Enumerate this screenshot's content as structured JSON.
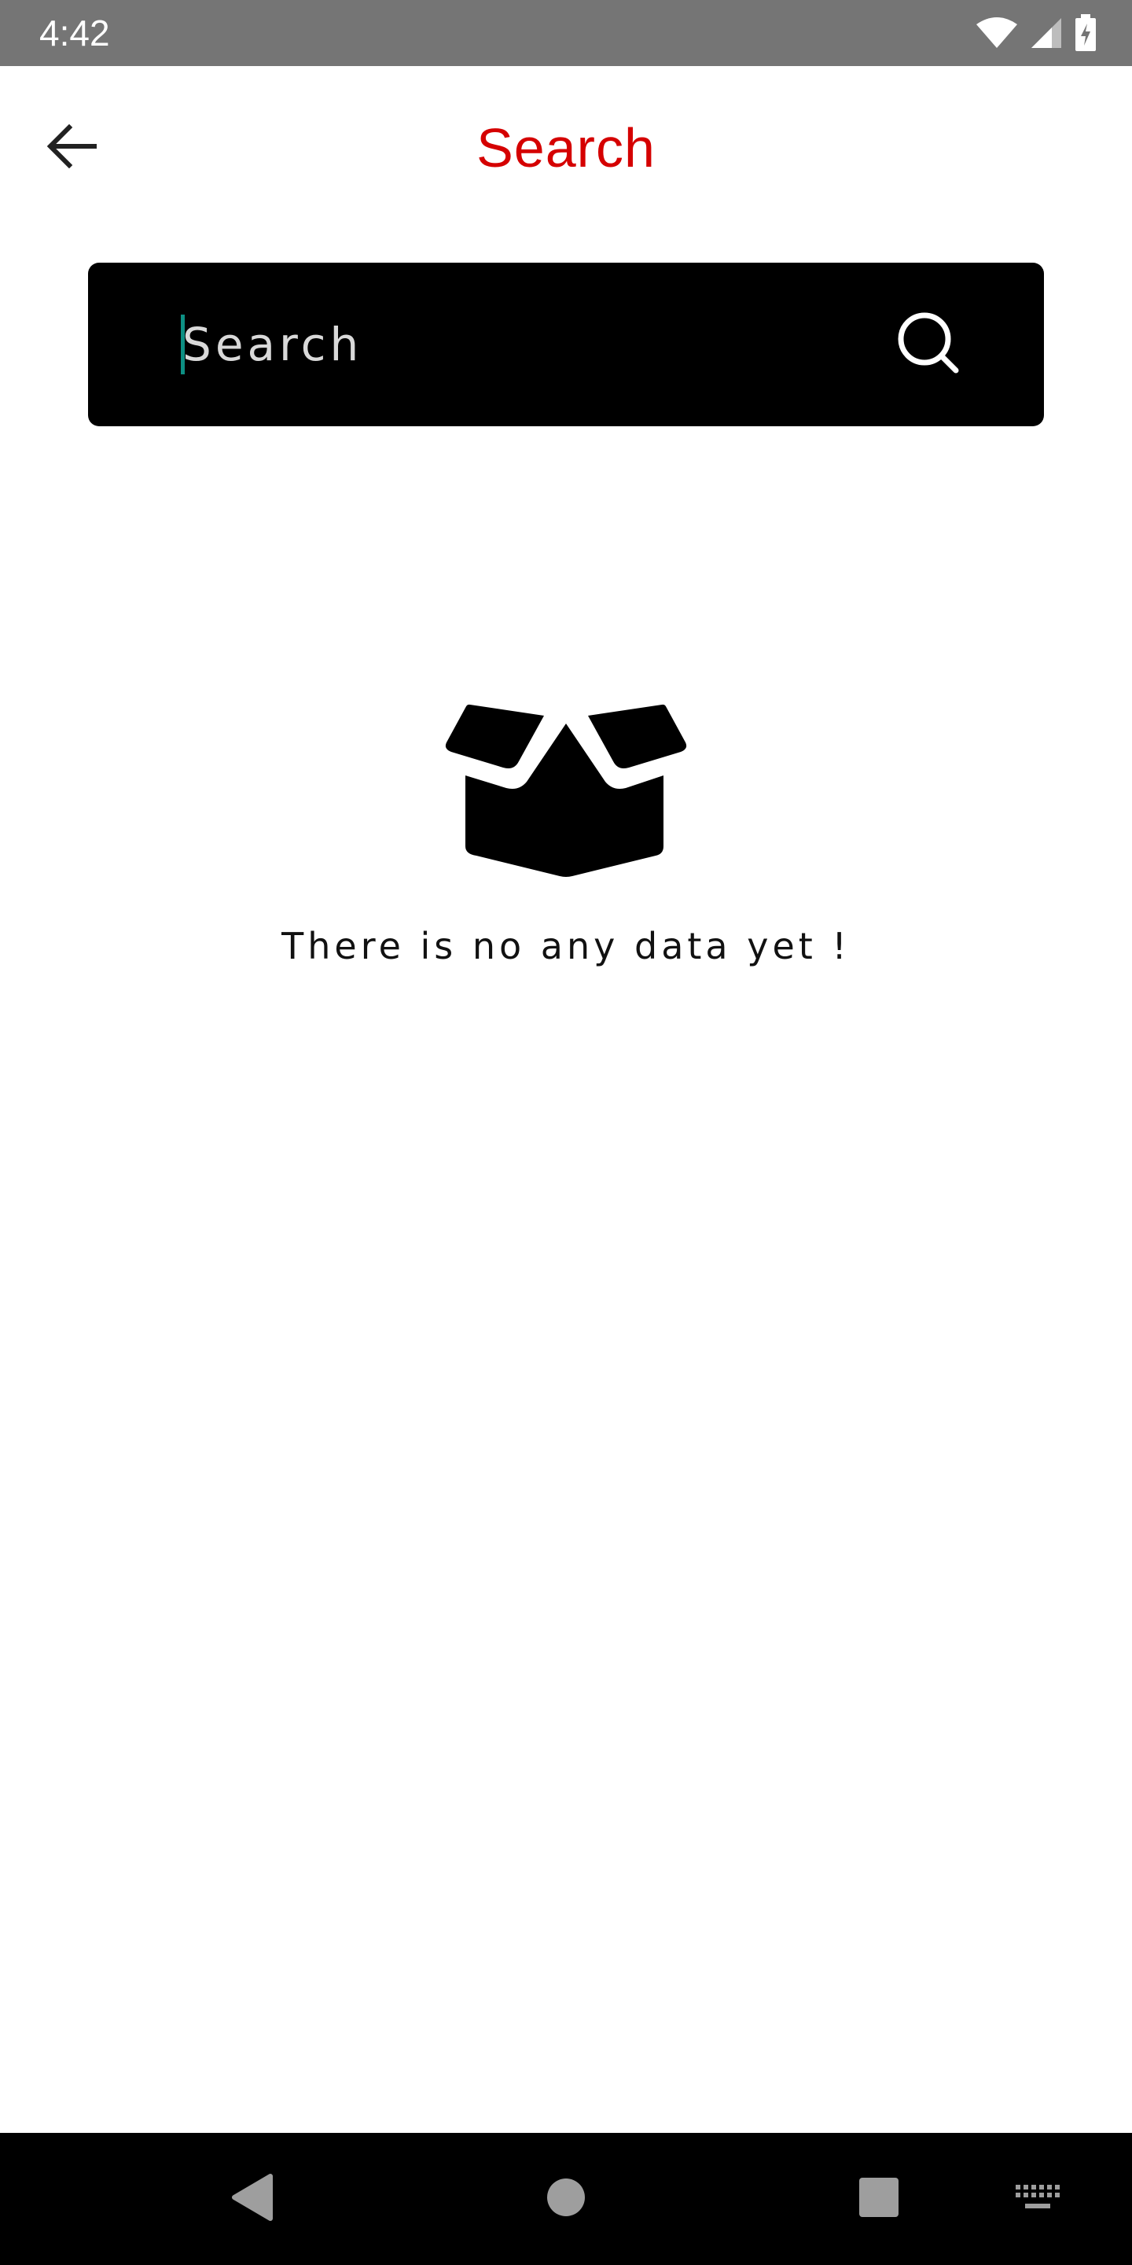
{
  "status_bar": {
    "time": "4:42",
    "icons": [
      "wifi-icon",
      "cellular-signal-icon",
      "battery-charging-icon"
    ]
  },
  "app_bar": {
    "title": "Search",
    "title_color": "#d50000",
    "back_icon": "arrow-left-icon"
  },
  "search": {
    "placeholder": "Search",
    "value": "",
    "icon": "search-icon",
    "background_color": "#000000",
    "cursor_color": "#0d8f83"
  },
  "empty_state": {
    "icon": "open-box-icon",
    "message": "There is no any data yet !"
  },
  "nav_bar": {
    "icons": [
      "nav-back-icon",
      "nav-home-icon",
      "nav-recents-icon",
      "keyboard-icon"
    ]
  }
}
